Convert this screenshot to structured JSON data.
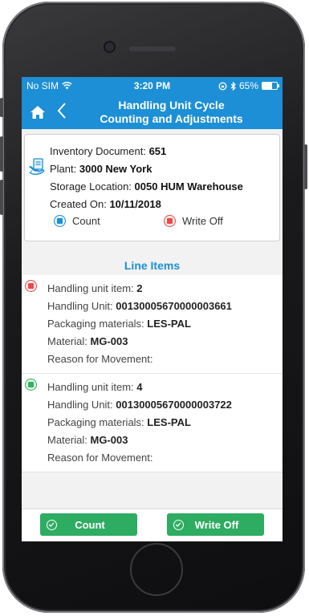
{
  "status_bar": {
    "carrier": "No SIM",
    "time": "3:20 PM",
    "battery": "65%",
    "battery_level": 0.65
  },
  "header": {
    "title_line1": "Handling Unit Cycle",
    "title_line2": "Counting and Adjustments"
  },
  "document": {
    "inventory_label": "Inventory Document:",
    "inventory_value": "651",
    "plant_label": "Plant:",
    "plant_value": "3000 New York",
    "storage_label": "Storage Location:",
    "storage_value": "0050 HUM Warehouse",
    "created_label": "Created On:",
    "created_value": "10/11/2018",
    "count_label": "Count",
    "writeoff_label": "Write Off"
  },
  "line_items_header": "Line Items",
  "line_items": [
    {
      "status_color": "#e84a4a",
      "hu_item_label": "Handling unit item:",
      "hu_item_value": "2",
      "hu_label": "Handling Unit:",
      "hu_value": "00130005670000003661",
      "pkg_label": "Packaging materials:",
      "pkg_value": "LES-PAL",
      "material_label": "Material:",
      "material_value": "MG-003",
      "reason_label": "Reason for Movement:"
    },
    {
      "status_color": "#2db35a",
      "hu_item_label": "Handling unit item:",
      "hu_item_value": "4",
      "hu_label": "Handling Unit:",
      "hu_value": "00130005670000003722",
      "pkg_label": "Packaging materials:",
      "pkg_value": "LES-PAL",
      "material_label": "Material:",
      "material_value": "MG-003",
      "reason_label": "Reason for Movement:"
    }
  ],
  "footer": {
    "count_button": "Count",
    "writeoff_button": "Write Off"
  },
  "colors": {
    "brand": "#1c8fd6",
    "action_green": "#2eac62",
    "status_red": "#e84a4a",
    "status_green": "#2db35a"
  }
}
